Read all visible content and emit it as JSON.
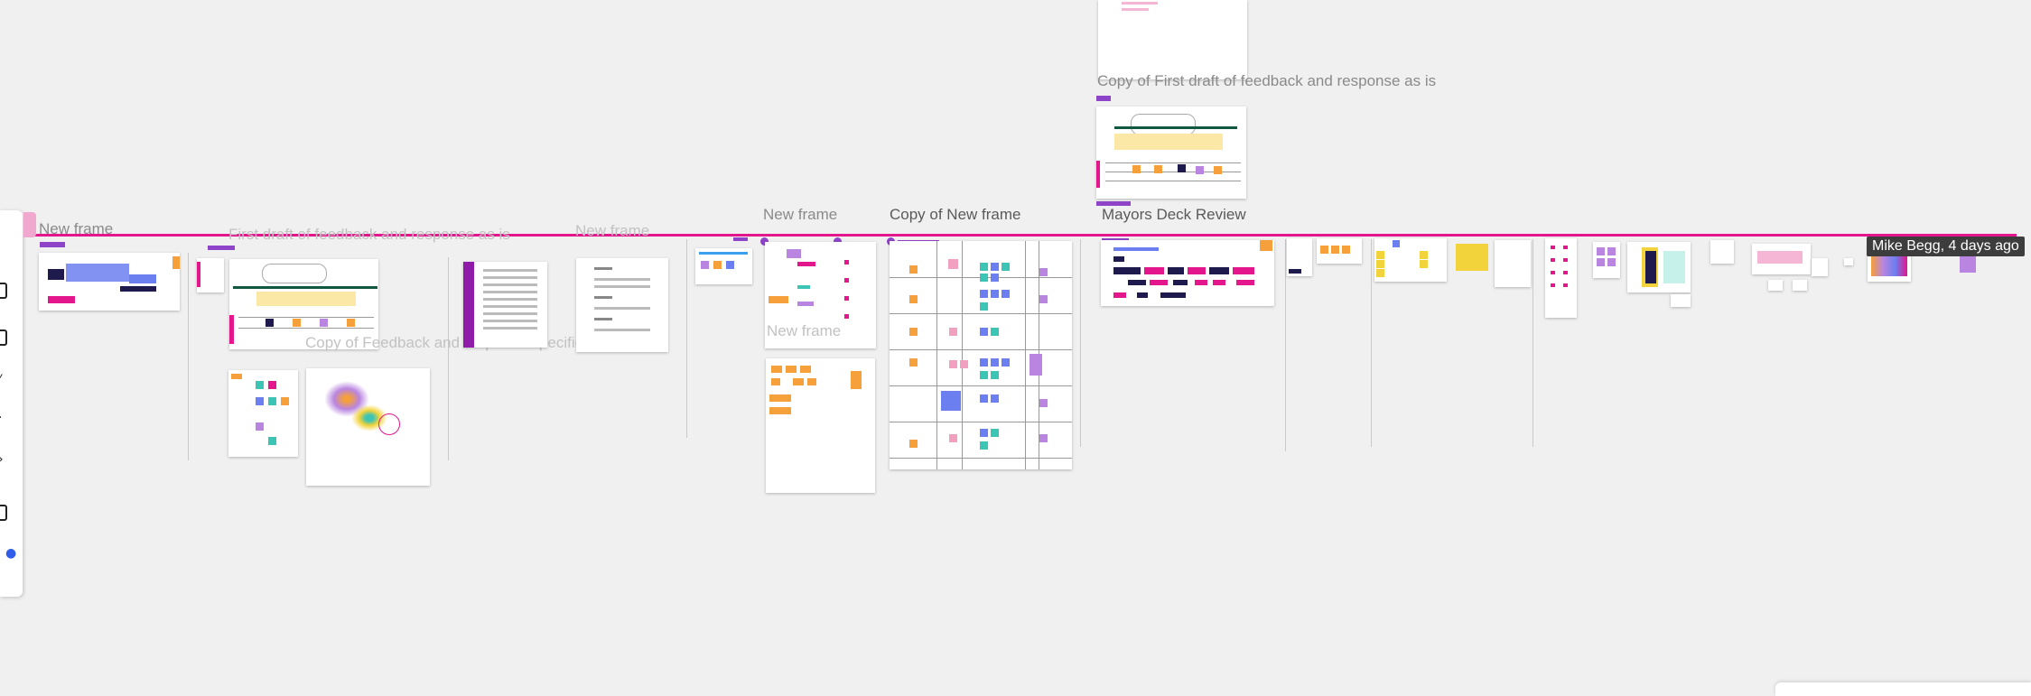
{
  "board": {
    "frames": {
      "new_frame_1": "New frame",
      "first_draft": "First draft of feedback and response as is",
      "new_frame_2": "New frame",
      "new_frame_3": "New frame",
      "new_frame_4": "New frame",
      "copy_new_frame": "Copy of New frame",
      "mayors_deck": "Mayors Deck Review",
      "copy_first_draft": "Copy of First draft of feedback and response as is",
      "copy_feedback_insights": "Copy of Feedback and response specific insights"
    },
    "collaborator_cursor": "Mike Begg, 4 days ago"
  },
  "colors": {
    "accent_pink": "#e3168b",
    "purple": "#8e44c8",
    "orange": "#f5a03a",
    "navy": "#1f1a4d",
    "teal": "#3cc4b4",
    "blue": "#6c7ff0",
    "lavender": "#b985e0",
    "yellow": "#f2d33c"
  },
  "toolbar": {
    "tools": [
      "select-tool-icon",
      "frame-tool-icon",
      "pen-tool-icon",
      "line-tool-icon",
      "connector-tool-icon",
      "shape-tool-icon",
      "more-tools-icon"
    ]
  }
}
